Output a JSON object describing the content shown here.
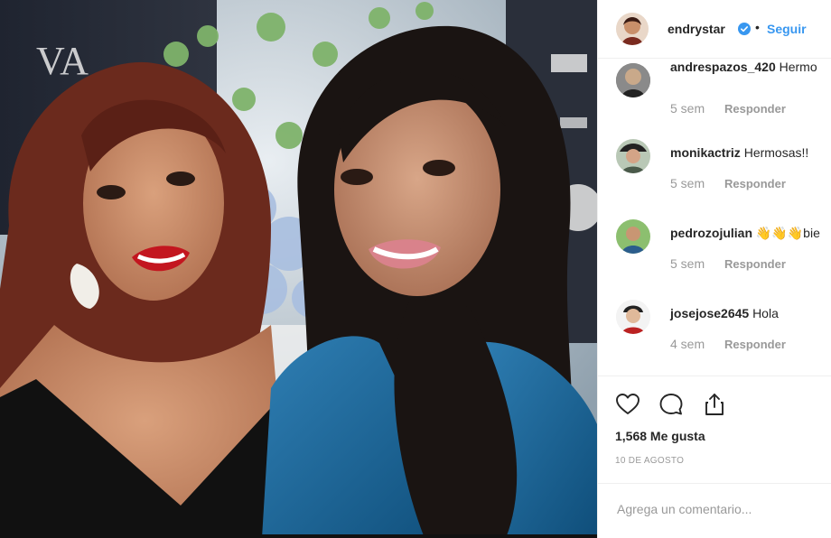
{
  "post": {
    "image_alt": "",
    "author": {
      "username": "endrystar",
      "verified": true,
      "follow_label": "Seguir",
      "separator": "•"
    },
    "comments": [
      {
        "username": "andrespazos_420",
        "text": "Hermo",
        "time": "5 sem",
        "reply_label": "Responder",
        "avatar_color": "#6b6b6b"
      },
      {
        "username": "monikactriz",
        "text": "Hermosas!!",
        "time": "5 sem",
        "reply_label": "Responder",
        "avatar_color": "#4a5a4a"
      },
      {
        "username": "pedrozojulian",
        "text": "👋👋👋bie",
        "time": "5 sem",
        "reply_label": "Responder",
        "avatar_color": "#3b7a3b"
      },
      {
        "username": "josejose2645",
        "text": "Hola",
        "time": "4 sem",
        "reply_label": "Responder",
        "avatar_color": "#c9a98a"
      }
    ],
    "actions": {
      "like_icon": "heart-icon",
      "comment_icon": "comment-icon",
      "share_icon": "share-icon"
    },
    "likes_text": "1,568 Me gusta",
    "date_text": "10 DE AGOSTO",
    "add_comment_placeholder": "Agrega un comentario..."
  },
  "colors": {
    "link_blue": "#3897f0",
    "verified_blue": "#3897f0",
    "muted": "#999999",
    "text": "#262626",
    "border": "#efefef"
  }
}
